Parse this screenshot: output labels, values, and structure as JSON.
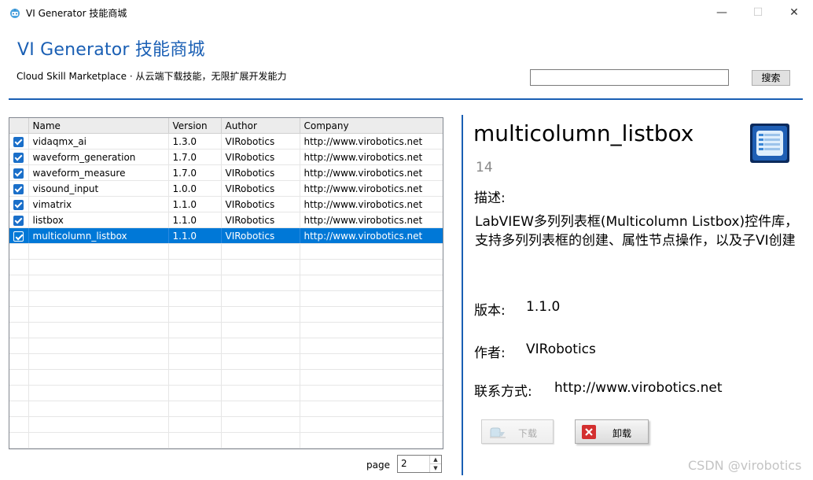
{
  "window": {
    "title": "VI Generator  技能商城",
    "minimize_glyph": "—",
    "maximize_glyph": "☐",
    "close_glyph": "✕"
  },
  "header": {
    "title": "VI Generator  技能商城",
    "subtitle": "Cloud Skill Marketplace  ·  从云端下载技能，无限扩展开发能力"
  },
  "search": {
    "value": "",
    "button_label": "搜索"
  },
  "table": {
    "columns": [
      "Name",
      "Version",
      "Author",
      "Company"
    ],
    "rows": [
      {
        "name": "vidaqmx_ai",
        "version": "1.3.0",
        "author": "VIRobotics",
        "company": "http://www.virobotics.net",
        "checked": true
      },
      {
        "name": "waveform_generation",
        "version": "1.7.0",
        "author": "VIRobotics",
        "company": "http://www.virobotics.net",
        "checked": true
      },
      {
        "name": "waveform_measure",
        "version": "1.7.0",
        "author": "VIRobotics",
        "company": "http://www.virobotics.net",
        "checked": true
      },
      {
        "name": "visound_input",
        "version": "1.0.0",
        "author": "VIRobotics",
        "company": "http://www.virobotics.net",
        "checked": true
      },
      {
        "name": "vimatrix",
        "version": "1.1.0",
        "author": "VIRobotics",
        "company": "http://www.virobotics.net",
        "checked": true
      },
      {
        "name": "listbox",
        "version": "1.1.0",
        "author": "VIRobotics",
        "company": "http://www.virobotics.net",
        "checked": true
      },
      {
        "name": "multicolumn_listbox",
        "version": "1.1.0",
        "author": "VIRobotics",
        "company": "http://www.virobotics.net",
        "checked": true,
        "selected": true
      }
    ]
  },
  "pager": {
    "label": "page",
    "value": "2"
  },
  "detail": {
    "name": "multicolumn_listbox",
    "count": "14",
    "desc_label": "描述:",
    "description": "LabVIEW多列列表框(Multicolumn Listbox)控件库，支持多列列表框的创建、属性节点操作，以及子VI创建",
    "version_label": "版本:",
    "version": "1.1.0",
    "author_label": "作者:",
    "author": "VIRobotics",
    "contact_label": "联系方式:",
    "contact": "http://www.virobotics.net",
    "download_label": "下载",
    "uninstall_label": "卸载"
  },
  "watermark": "CSDN @virobotics",
  "colors": {
    "accent": "#1a5fb4",
    "selection": "#0078d7",
    "checkbox": "#1a6fc9",
    "uninstall_icon": "#d32f2f"
  }
}
